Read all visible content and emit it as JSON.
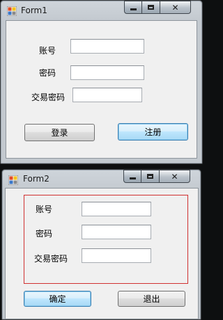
{
  "form1": {
    "title": "Form1",
    "labels": {
      "account": "账号",
      "password": "密码",
      "trade_password": "交易密码"
    },
    "inputs": {
      "account": "",
      "password": "",
      "trade_password": ""
    },
    "buttons": {
      "login": "登录",
      "register": "注册"
    }
  },
  "form2": {
    "title": "Form2",
    "labels": {
      "account": "账号",
      "password": "密码",
      "trade_password": "交易密码"
    },
    "inputs": {
      "account": "",
      "password": "",
      "trade_password": ""
    },
    "buttons": {
      "confirm": "确定",
      "exit": "退出"
    }
  },
  "colors": {
    "panel_border": "#d03030",
    "focus_blue": "#3c7fb1"
  },
  "icons": [
    "app-icon",
    "minimize-icon",
    "maximize-icon",
    "close-icon"
  ]
}
